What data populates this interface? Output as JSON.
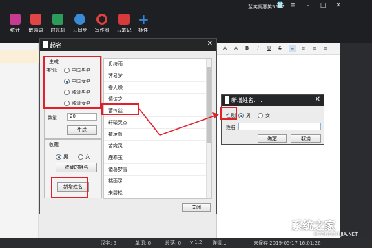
{
  "app": {
    "username": "蜚笑就悪笑5527",
    "toolbar": [
      {
        "label": "统计",
        "icon": "chart-icon",
        "color": "#c63b8f"
      },
      {
        "label": "敏感词",
        "icon": "sensitive-words-icon",
        "color": "#e04646"
      },
      {
        "label": "时光机",
        "icon": "time-machine-icon",
        "color": "#2d9c5a"
      },
      {
        "label": "云同步",
        "icon": "cloud-sync-icon",
        "color": "#3a8ad6"
      },
      {
        "label": "写作圈",
        "icon": "writing-circle-icon",
        "color": "#e0413f"
      },
      {
        "label": "云笔记",
        "icon": "cloud-note-icon",
        "color": "#d63a3a"
      },
      {
        "label": "插件",
        "icon": "plugin-plus-icon",
        "color": "#2f86d9"
      }
    ],
    "window_controls": [
      "shirt-icon",
      "menu-icon",
      "minimize-icon",
      "restore-icon",
      "close-icon"
    ],
    "format_buttons": [
      "A",
      "A",
      "B",
      "I",
      "U",
      "S",
      "≡",
      "≡",
      "≡",
      "≡"
    ],
    "status": {
      "chars": "汉字: 5",
      "words": "单词: 0",
      "paragraphs": "段落: 0",
      "version": "v 1.2",
      "detail": "详情...",
      "saved": "未保存 2019-05-17 16:01:26"
    }
  },
  "naming_dialog": {
    "title": "起名",
    "generate_group": {
      "title": "生成",
      "category_label": "类别:",
      "options": [
        {
          "label": "中国男名",
          "selected": false
        },
        {
          "label": "中国女名",
          "selected": true
        },
        {
          "label": "欧洲男名",
          "selected": false
        },
        {
          "label": "欧洲女名",
          "selected": false
        }
      ],
      "count_label": "数量",
      "count_value": "20",
      "generate_button": "生成"
    },
    "favorites_group": {
      "title": "收藏",
      "gender_options": [
        {
          "label": "男",
          "selected": true
        },
        {
          "label": "女",
          "selected": false
        }
      ],
      "favorites_button": "收藏的姓名",
      "add_name_button": "新增姓名"
    },
    "names": [
      "毋绮雨",
      "荠易梦",
      "春天燥",
      "僖访之",
      "蓄怜丝",
      "轩辕灵杰",
      "瞿凌蔚",
      "苦宛灵",
      "鹿寒玉",
      "诸葛梦雪",
      "揣雨灵",
      "来碧松"
    ],
    "close_button": "关闭"
  },
  "new_name_dialog": {
    "title": "新增姓名. . .",
    "gender_label": "性别",
    "gender_options": [
      {
        "label": "男",
        "selected": true
      },
      {
        "label": "女",
        "selected": false
      }
    ],
    "name_label": "姓名",
    "name_value": "",
    "ok_button": "确定",
    "cancel_button": "取消"
  },
  "watermark": {
    "text": "系统之家",
    "url": "XITONGZHIJIA.NET"
  },
  "colors": {
    "highlight": "#e0202a",
    "titlebar": "#242628"
  }
}
